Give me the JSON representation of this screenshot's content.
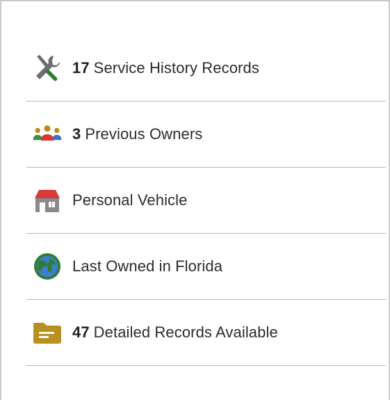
{
  "items": [
    {
      "icon": "tools-icon",
      "count": "17",
      "label": "Service History Records"
    },
    {
      "icon": "people-icon",
      "count": "3",
      "label": "Previous Owners"
    },
    {
      "icon": "house-icon",
      "count": "",
      "label": "Personal Vehicle"
    },
    {
      "icon": "globe-icon",
      "count": "",
      "label": "Last Owned in Florida"
    },
    {
      "icon": "folder-icon",
      "count": "47",
      "label": "Detailed Records Available"
    }
  ],
  "colors": {
    "tool_green": "#2e7d32",
    "tool_gray": "#6d6d6d",
    "people_gold": "#c08a1e",
    "people_red": "#d23a33",
    "people_green": "#3f8f3a",
    "people_blue": "#3b72c4",
    "house_red": "#d93a36",
    "house_gray": "#8a8a8a",
    "globe_blue": "#3f7ecf",
    "globe_green": "#2e7d32",
    "folder_gold": "#b8901d",
    "divider": "#b8b8b8"
  }
}
